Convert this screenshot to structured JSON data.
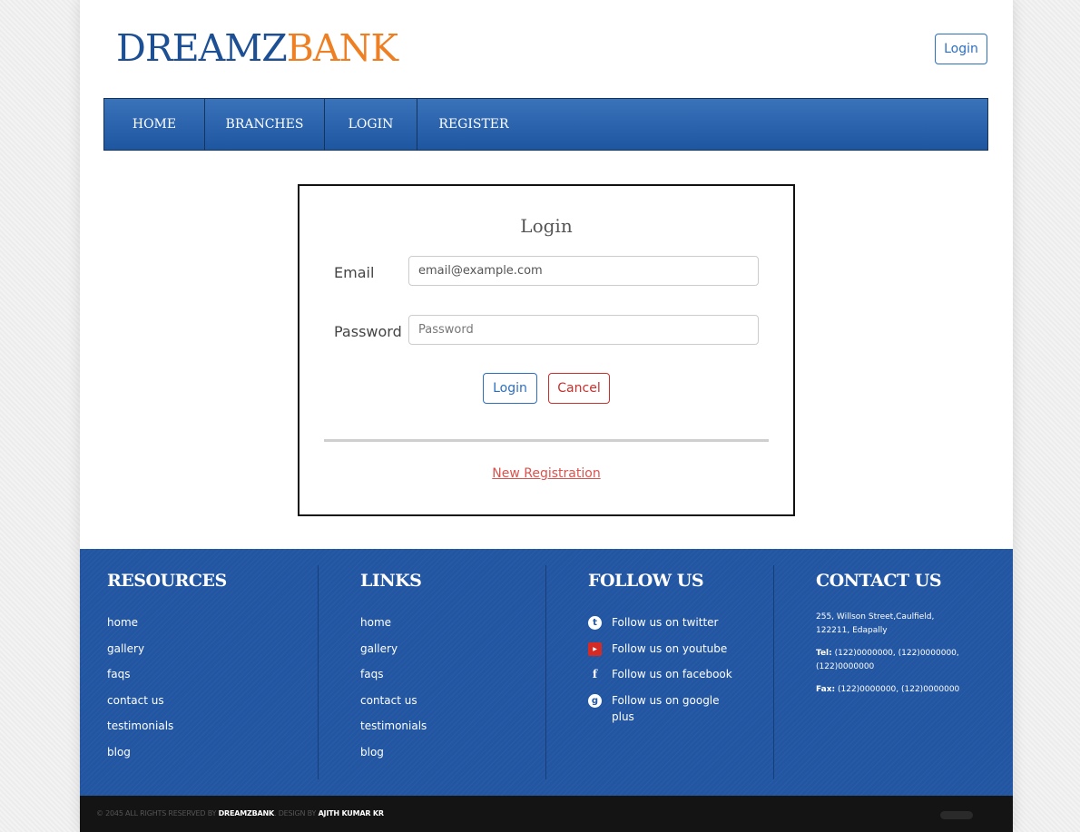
{
  "header": {
    "logo_part1": "DREAMZ",
    "logo_part2": "BANK",
    "login_button": "Login"
  },
  "nav": {
    "items": [
      "HOME",
      "BRANCHES",
      "LOGIN",
      "REGISTER"
    ]
  },
  "login_form": {
    "title": "Login",
    "email_label": "Email",
    "email_value": "email@example.com",
    "password_label": "Password",
    "password_placeholder": "Password",
    "login_button": "Login",
    "cancel_button": "Cancel",
    "new_registration_link": "New Registration"
  },
  "footer": {
    "resources": {
      "title": "RESOURCES",
      "items": [
        "home",
        "gallery",
        "faqs",
        "contact us",
        "testimonials",
        "blog"
      ]
    },
    "links": {
      "title": "LINKS",
      "items": [
        "home",
        "gallery",
        "faqs",
        "contact us",
        "testimonials",
        "blog"
      ]
    },
    "follow": {
      "title": "FOLLOW US",
      "items": [
        {
          "icon": "twitter-icon",
          "text": "Follow us on twitter"
        },
        {
          "icon": "youtube-icon",
          "text": "Follow us on youtube"
        },
        {
          "icon": "facebook-icon",
          "text": "Follow us on facebook"
        },
        {
          "icon": "google-plus-icon",
          "text": "Follow us on google plus"
        }
      ]
    },
    "contact": {
      "title": "CONTACT US",
      "address": "255, Willson Street,Caulfield, 122211, Edapally",
      "tel_label": "Tel:",
      "tel_value": "(122)0000000, (122)0000000, (122)0000000",
      "fax_label": "Fax:",
      "fax_value": "(122)0000000, (122)0000000"
    }
  },
  "bottom_bar": {
    "copyright_prefix": "© 2045 ALL RIGHTS RESERVED BY",
    "brand": "DREAMZBANK",
    "design_by": ". DESIGN BY",
    "designer": "AJITH KUMAR KR"
  },
  "colors": {
    "brand_blue": "#1d4f94",
    "brand_orange": "#ee7f22",
    "footer_blue": "#2256a2",
    "nav_blue": "#2b64ae"
  }
}
